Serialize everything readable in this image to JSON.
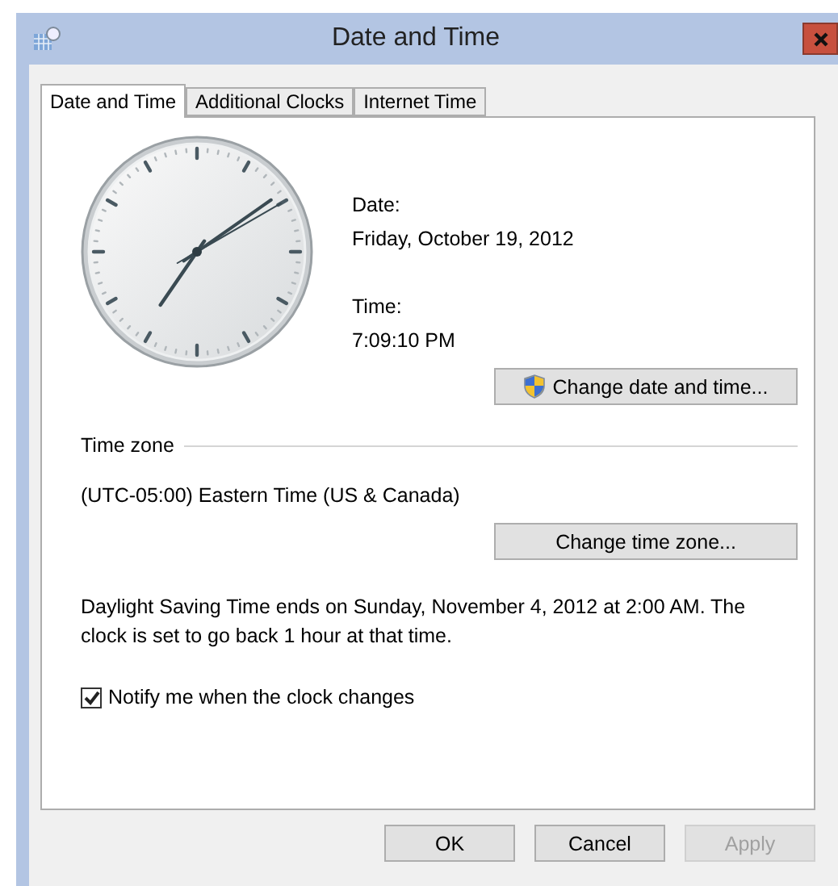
{
  "window": {
    "title": "Date and Time"
  },
  "tabs": [
    {
      "label": "Date and Time",
      "selected": true
    },
    {
      "label": "Additional Clocks",
      "selected": false
    },
    {
      "label": "Internet Time",
      "selected": false
    }
  ],
  "date": {
    "label": "Date:",
    "value": "Friday, October 19, 2012"
  },
  "time": {
    "label": "Time:",
    "value": "7:09:10 PM"
  },
  "change_date_button": "Change date and time...",
  "time_zone": {
    "heading": "Time zone",
    "value": "(UTC-05:00) Eastern Time (US & Canada)",
    "button": "Change time zone..."
  },
  "dst_note": "Daylight Saving Time ends on Sunday, November 4, 2012 at 2:00 AM. The clock is set to go back 1 hour at that time.",
  "notify": {
    "label": "Notify me when the clock changes",
    "checked": true
  },
  "buttons": [
    {
      "label": "OK",
      "disabled": false
    },
    {
      "label": "Cancel",
      "disabled": false
    },
    {
      "label": "Apply",
      "disabled": true
    }
  ]
}
